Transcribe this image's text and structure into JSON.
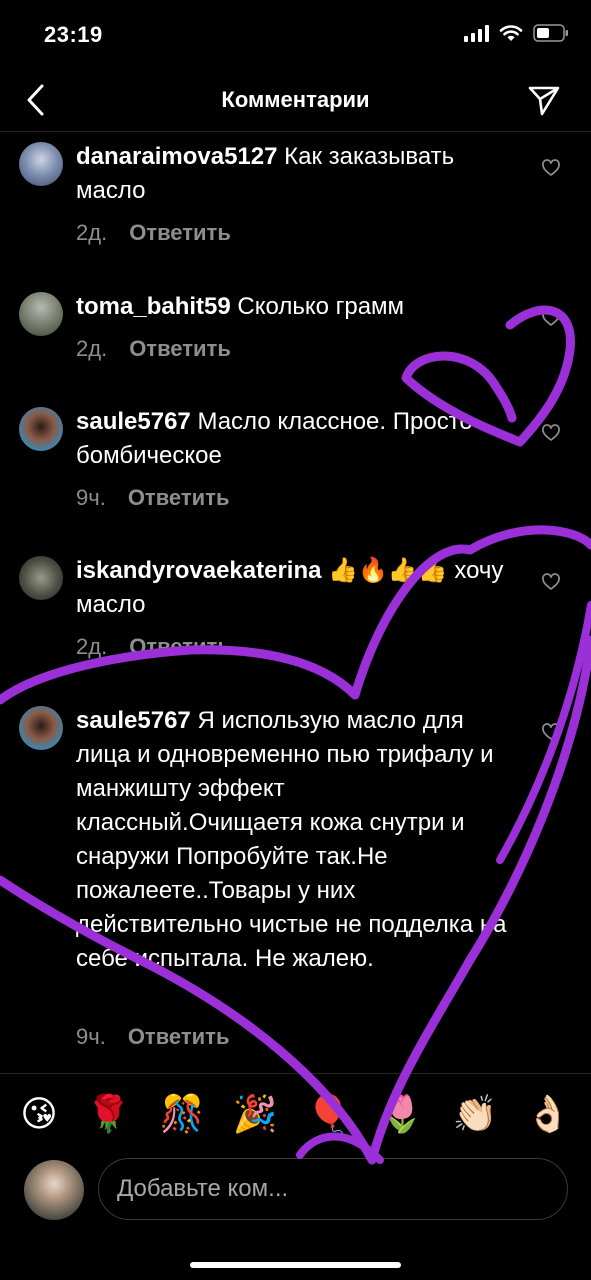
{
  "status_bar": {
    "time": "23:19"
  },
  "header": {
    "title": "Комментарии"
  },
  "comments": [
    {
      "username": "danaraimova5127",
      "text": "Как заказывать масло",
      "age": "2д.",
      "reply_label": "Ответить"
    },
    {
      "username": "toma_bahit59",
      "text": "Сколько грамм",
      "age": "2д.",
      "reply_label": "Ответить"
    },
    {
      "username": "saule5767",
      "text": "Масло классное. Просто бомбическое",
      "age": "9ч.",
      "reply_label": "Ответить"
    },
    {
      "username": "iskandyrovaekaterina",
      "text": "👍🔥👍👍 хочу масло",
      "age": "2д.",
      "reply_label": "Ответить"
    },
    {
      "username": "saule5767",
      "text": "Я использую масло для лица и одновременно пью трифалу и манжишту эффект классный.Очищаетя кожа снутри и снаружи Попробуйте так.Не пожалеете..Товары у них действительно чистые не подделка  на себе испытала. Не жалею.",
      "age": "9ч.",
      "reply_label": "Ответить"
    }
  ],
  "emoji_bar": [
    "😘",
    "🌹",
    "🎊",
    "🎉",
    "🎈",
    "🌷",
    "👏🏻",
    "👌🏻"
  ],
  "composer": {
    "placeholder": "Добавьте ком..."
  },
  "colors": {
    "background": "#000000",
    "secondary_text": "#8e8e8e",
    "drawing": "#9b30d9"
  },
  "icons": {
    "back": "chevron-left-icon",
    "share": "paper-plane-icon",
    "like": "heart-outline-icon"
  }
}
